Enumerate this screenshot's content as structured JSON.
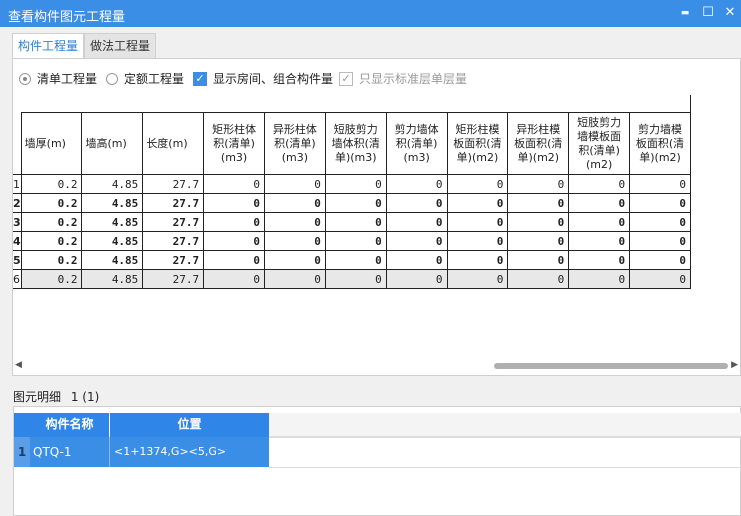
{
  "window": {
    "title": "查看构件图元工程量",
    "minimize": "▬",
    "maximize": "☐",
    "close": "✕"
  },
  "tabs": [
    {
      "label": "构件工程量",
      "active": true
    },
    {
      "label": "做法工程量",
      "active": false
    }
  ],
  "options": {
    "radio_list": "清单工程量",
    "radio_quota": "定额工程量",
    "check_rooms": "显示房间、组合构件量",
    "check_std_floor": "只显示标准层单层量"
  },
  "table": {
    "headers": [
      "墙厚(m)",
      "墙高(m)",
      "长度(m)",
      "矩形柱体积(清单)(m3)",
      "异形柱体积(清单)(m3)",
      "短肢剪力墙体积(清单)(m3)",
      "剪力墙体积(清单)(m3)",
      "矩形柱模板面积(清单)(m2)",
      "异形柱模板面积(清单)(m2)",
      "短肢剪力墙模板面积(清单)(m2)",
      "剪力墙模板面积(清单)(m2)"
    ],
    "rows": [
      {
        "n": "1",
        "cells": [
          "0.2",
          "4.85",
          "27.7",
          "0",
          "0",
          "0",
          "0",
          "0",
          "0",
          "0",
          "0"
        ]
      },
      {
        "n": "2",
        "cells": [
          "0.2",
          "4.85",
          "27.7",
          "0",
          "0",
          "0",
          "0",
          "0",
          "0",
          "0",
          "0"
        ]
      },
      {
        "n": "3",
        "cells": [
          "0.2",
          "4.85",
          "27.7",
          "0",
          "0",
          "0",
          "0",
          "0",
          "0",
          "0",
          "0"
        ]
      },
      {
        "n": "4",
        "cells": [
          "0.2",
          "4.85",
          "27.7",
          "0",
          "0",
          "0",
          "0",
          "0",
          "0",
          "0",
          "0"
        ]
      },
      {
        "n": "5",
        "cells": [
          "0.2",
          "4.85",
          "27.7",
          "0",
          "0",
          "0",
          "0",
          "0",
          "0",
          "0",
          "0"
        ]
      },
      {
        "n": "6",
        "cells": [
          "0.2",
          "4.85",
          "27.7",
          "0",
          "0",
          "0",
          "0",
          "0",
          "0",
          "0",
          "0"
        ]
      }
    ]
  },
  "detail": {
    "label": "图元明细",
    "count": "1 (1)",
    "headers": [
      "构件名称",
      "位置"
    ],
    "rows": [
      {
        "n": "1",
        "name": "QTQ-1",
        "position": "<1+1374,G><5,G>"
      }
    ]
  }
}
